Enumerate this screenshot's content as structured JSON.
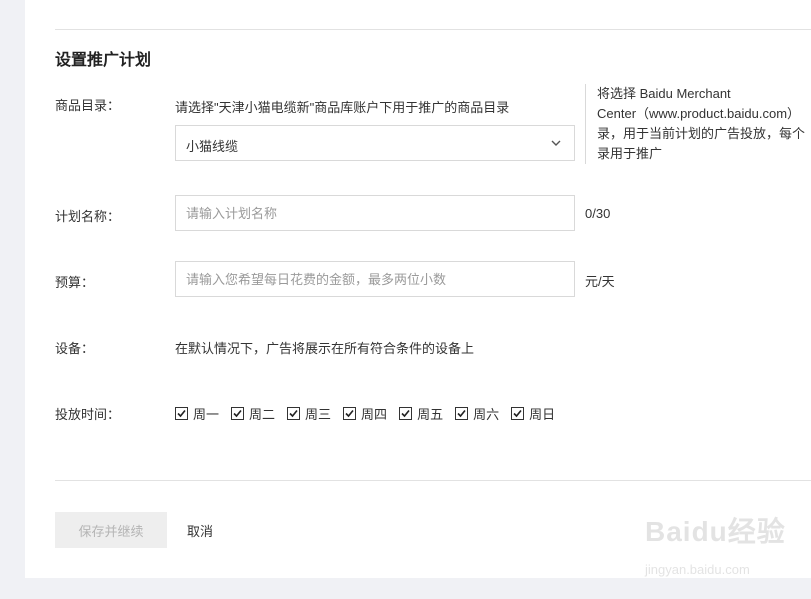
{
  "section": {
    "title": "设置推广计划"
  },
  "catalog": {
    "label": "商品目录：",
    "hint": "请选择\"天津小猫电缆新\"商品库账户下用于推广的商品目录",
    "selected": "小猫线缆",
    "note_lines": [
      "将选择 Baidu Merchant",
      "Center（www.product.baidu.com）",
      "录，用于当前计划的广告投放，每个",
      "录用于推广"
    ]
  },
  "plan_name": {
    "label": "计划名称：",
    "placeholder": "请输入计划名称",
    "counter": "0/30"
  },
  "budget": {
    "label": "预算：",
    "placeholder": "请输入您希望每日花费的金额，最多两位小数",
    "unit": "元/天"
  },
  "device": {
    "label": "设备：",
    "text": "在默认情况下，广告将展示在所有符合条件的设备上"
  },
  "schedule": {
    "label": "投放时间：",
    "days": [
      {
        "label": "周一",
        "checked": true
      },
      {
        "label": "周二",
        "checked": true
      },
      {
        "label": "周三",
        "checked": true
      },
      {
        "label": "周四",
        "checked": true
      },
      {
        "label": "周五",
        "checked": true
      },
      {
        "label": "周六",
        "checked": true
      },
      {
        "label": "周日",
        "checked": true
      }
    ]
  },
  "actions": {
    "save": "保存并继续",
    "cancel": "取消"
  },
  "watermark": {
    "logo": "Baidu经验",
    "url": "jingyan.baidu.com"
  }
}
